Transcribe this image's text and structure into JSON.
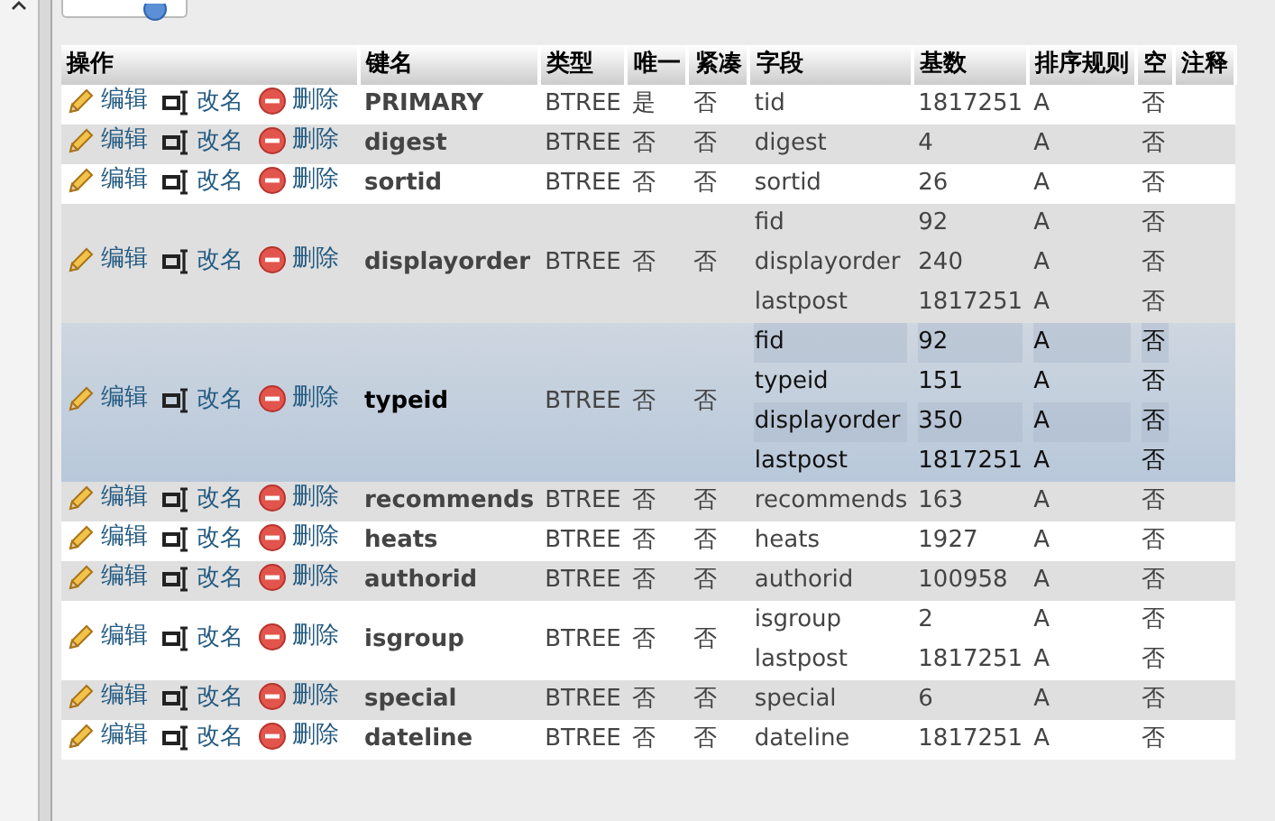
{
  "table": {
    "columns": [
      "操作",
      "键名",
      "类型",
      "唯一",
      "紧凑",
      "字段",
      "基数",
      "排序规则",
      "空",
      "注释"
    ],
    "rows": [
      {
        "edit": "编辑",
        "rename": "改名",
        "drop": "删除",
        "name": "PRIMARY",
        "type": "BTREE",
        "unique": "是",
        "packed": "否",
        "highlighted": false,
        "fields": [
          {
            "field": "tid",
            "cardinality": "1817251",
            "collation": "A",
            "null": "否"
          }
        ]
      },
      {
        "edit": "编辑",
        "rename": "改名",
        "drop": "删除",
        "name": "digest",
        "type": "BTREE",
        "unique": "否",
        "packed": "否",
        "highlighted": false,
        "fields": [
          {
            "field": "digest",
            "cardinality": "4",
            "collation": "A",
            "null": "否"
          }
        ]
      },
      {
        "edit": "编辑",
        "rename": "改名",
        "drop": "删除",
        "name": "sortid",
        "type": "BTREE",
        "unique": "否",
        "packed": "否",
        "highlighted": false,
        "fields": [
          {
            "field": "sortid",
            "cardinality": "26",
            "collation": "A",
            "null": "否"
          }
        ]
      },
      {
        "edit": "编辑",
        "rename": "改名",
        "drop": "删除",
        "name": "displayorder",
        "type": "BTREE",
        "unique": "否",
        "packed": "否",
        "highlighted": false,
        "fields": [
          {
            "field": "fid",
            "cardinality": "92",
            "collation": "A",
            "null": "否"
          },
          {
            "field": "displayorder",
            "cardinality": "240",
            "collation": "A",
            "null": "否"
          },
          {
            "field": "lastpost",
            "cardinality": "1817251",
            "collation": "A",
            "null": "否"
          }
        ]
      },
      {
        "edit": "编辑",
        "rename": "改名",
        "drop": "删除",
        "name": "typeid",
        "type": "BTREE",
        "unique": "否",
        "packed": "否",
        "highlighted": true,
        "fields": [
          {
            "field": "fid",
            "cardinality": "92",
            "collation": "A",
            "null": "否"
          },
          {
            "field": "typeid",
            "cardinality": "151",
            "collation": "A",
            "null": "否"
          },
          {
            "field": "displayorder",
            "cardinality": "350",
            "collation": "A",
            "null": "否"
          },
          {
            "field": "lastpost",
            "cardinality": "1817251",
            "collation": "A",
            "null": "否"
          }
        ]
      },
      {
        "edit": "编辑",
        "rename": "改名",
        "drop": "删除",
        "name": "recommends",
        "type": "BTREE",
        "unique": "否",
        "packed": "否",
        "highlighted": false,
        "fields": [
          {
            "field": "recommends",
            "cardinality": "163",
            "collation": "A",
            "null": "否"
          }
        ]
      },
      {
        "edit": "编辑",
        "rename": "改名",
        "drop": "删除",
        "name": "heats",
        "type": "BTREE",
        "unique": "否",
        "packed": "否",
        "highlighted": false,
        "fields": [
          {
            "field": "heats",
            "cardinality": "1927",
            "collation": "A",
            "null": "否"
          }
        ]
      },
      {
        "edit": "编辑",
        "rename": "改名",
        "drop": "删除",
        "name": "authorid",
        "type": "BTREE",
        "unique": "否",
        "packed": "否",
        "highlighted": false,
        "fields": [
          {
            "field": "authorid",
            "cardinality": "100958",
            "collation": "A",
            "null": "否"
          }
        ]
      },
      {
        "edit": "编辑",
        "rename": "改名",
        "drop": "删除",
        "name": "isgroup",
        "type": "BTREE",
        "unique": "否",
        "packed": "否",
        "highlighted": false,
        "fields": [
          {
            "field": "isgroup",
            "cardinality": "2",
            "collation": "A",
            "null": "否"
          },
          {
            "field": "lastpost",
            "cardinality": "1817251",
            "collation": "A",
            "null": "否"
          }
        ]
      },
      {
        "edit": "编辑",
        "rename": "改名",
        "drop": "删除",
        "name": "special",
        "type": "BTREE",
        "unique": "否",
        "packed": "否",
        "highlighted": false,
        "fields": [
          {
            "field": "special",
            "cardinality": "6",
            "collation": "A",
            "null": "否"
          }
        ]
      },
      {
        "edit": "编辑",
        "rename": "改名",
        "drop": "删除",
        "name": "dateline",
        "type": "BTREE",
        "unique": "否",
        "packed": "否",
        "highlighted": false,
        "fields": [
          {
            "field": "dateline",
            "cardinality": "1817251",
            "collation": "A",
            "null": "否"
          }
        ]
      }
    ]
  }
}
